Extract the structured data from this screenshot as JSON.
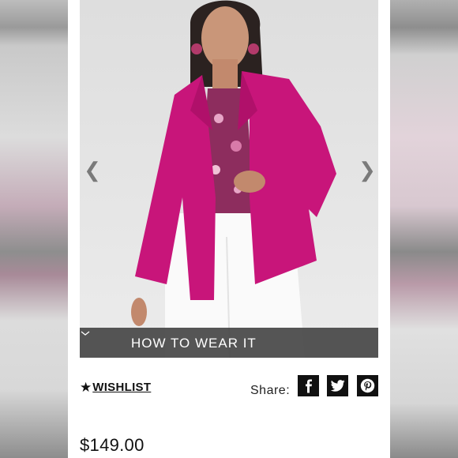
{
  "product": {
    "image_alt": "",
    "nav": {
      "prev_icon": "chevron-left-icon",
      "next_icon": "chevron-right-icon"
    },
    "how_to_wear_label": "HOW TO WEAR IT",
    "wishlist_label": "WISHLIST",
    "share_label": "Share:",
    "social": [
      "facebook-icon",
      "twitter-icon",
      "pinterest-icon"
    ],
    "price": "$149.00"
  },
  "colors": {
    "jacket": "#c8157a",
    "overlay": "#464646",
    "text": "#111111"
  }
}
